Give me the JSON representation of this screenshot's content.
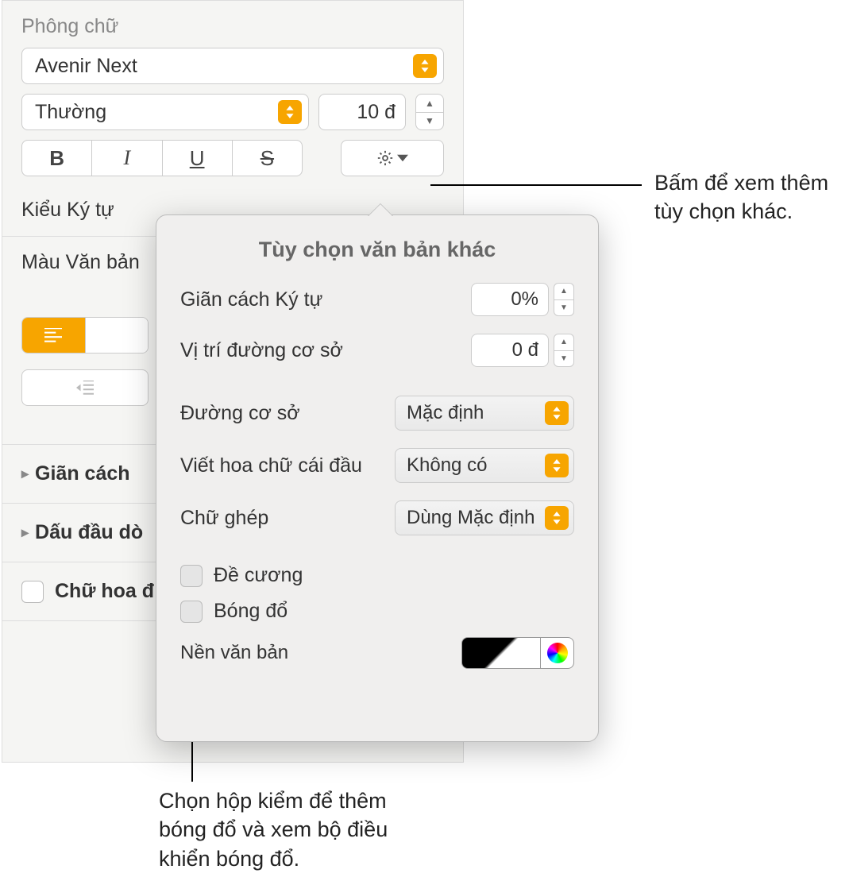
{
  "sidebar": {
    "font_section": "Phông chữ",
    "font_family": "Avenir Next",
    "typeface": "Thường",
    "size": "10 đ",
    "char_style": "Kiểu Ký tự",
    "text_color": "Màu Văn bản",
    "disclosure": {
      "spacing": "Giãn cách",
      "bullets": "Dấu đầu dò",
      "dropcap": "Chữ hoa đ"
    }
  },
  "popover": {
    "title": "Tùy chọn văn bản khác",
    "char_spacing_label": "Giãn cách Ký tự",
    "char_spacing_value": "0%",
    "baseline_shift_label": "Vị trí đường cơ sở",
    "baseline_shift_value": "0 đ",
    "baseline_label": "Đường cơ sở",
    "baseline_value": "Mặc định",
    "capitalization_label": "Viết hoa chữ cái đầu",
    "capitalization_value": "Không có",
    "ligatures_label": "Chữ ghép",
    "ligatures_value": "Dùng Mặc định",
    "outline": "Đề cương",
    "shadow": "Bóng đổ",
    "text_bg": "Nền văn bản"
  },
  "callouts": {
    "gear": "Bấm để xem thêm tùy chọn khác.",
    "shadow": "Chọn hộp kiểm để thêm bóng đổ và xem bộ điều khiển bóng đổ."
  }
}
